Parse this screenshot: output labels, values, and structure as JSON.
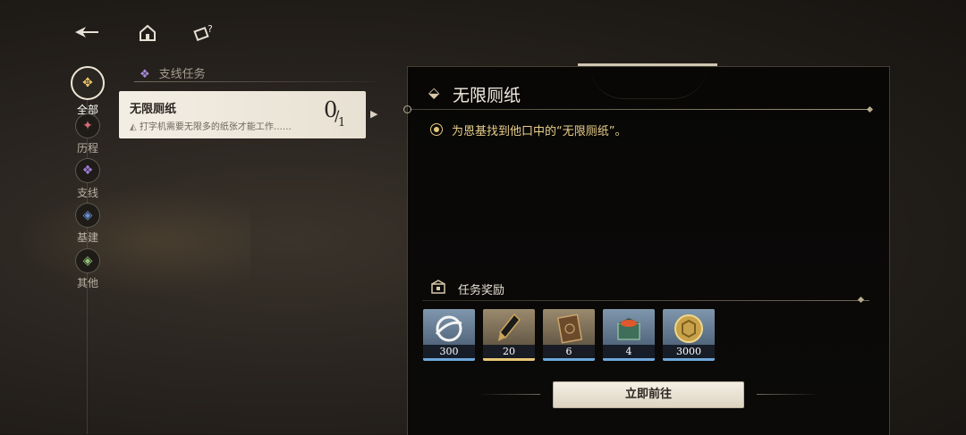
{
  "topbar": {
    "back_icon": "back-arrow-icon",
    "home_icon": "home-icon",
    "help_icon": "help-icon"
  },
  "categories": [
    {
      "label": "全部",
      "icon": "all-icon",
      "color": "#f0c56a",
      "active": true
    },
    {
      "label": "历程",
      "icon": "history-icon",
      "color": "#d56b7a",
      "active": false
    },
    {
      "label": "支线",
      "icon": "side-quest-icon",
      "color": "#9b7ad6",
      "active": false
    },
    {
      "label": "基建",
      "icon": "base-icon",
      "color": "#6a8fd6",
      "active": false
    },
    {
      "label": "其他",
      "icon": "other-icon",
      "color": "#8fc27a",
      "active": false
    }
  ],
  "section": {
    "title": "支线任务"
  },
  "quest": {
    "name": "无限厕纸",
    "desc": "打字机需要无限多的纸张才能工作……",
    "progress_current": "0",
    "progress_total": "1"
  },
  "detail": {
    "title": "无限厕纸",
    "objective": "为恩基找到他口中的“无限厕纸”。",
    "rewards_title": "任务奖励",
    "rewards": [
      {
        "icon": "currency-ring-icon",
        "qty": "300",
        "rarity": "blue"
      },
      {
        "icon": "crystal-pen-icon",
        "qty": "20",
        "rarity": "gold"
      },
      {
        "icon": "book-icon",
        "qty": "6",
        "rarity": "gold"
      },
      {
        "icon": "chest-icon",
        "qty": "4",
        "rarity": "blue"
      },
      {
        "icon": "gold-coin-icon",
        "qty": "3000",
        "rarity": "blue"
      }
    ],
    "go_button": "立即前往"
  },
  "colors": {
    "accent_gold": "#e9cf8a",
    "card_bg": "#f3eee4",
    "panel_bg": "#080706"
  }
}
